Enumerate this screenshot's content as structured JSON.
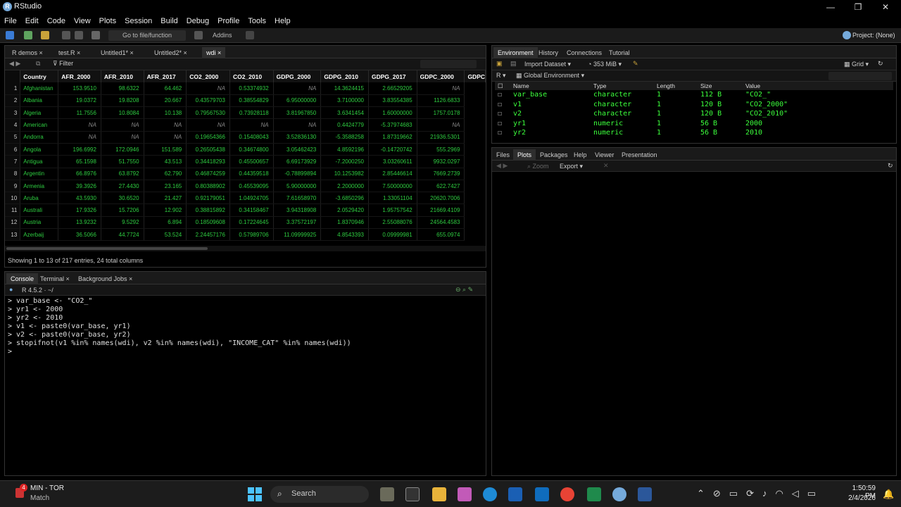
{
  "window": {
    "title": "RStudio",
    "min": "—",
    "max": "❐",
    "close": "✕"
  },
  "menu": [
    "File",
    "Edit",
    "Code",
    "View",
    "Plots",
    "Session",
    "Build",
    "Debug",
    "Profile",
    "Tools",
    "Help"
  ],
  "toolbar": {
    "goto_placeholder": "Go to file/function",
    "addins": "Addins",
    "project": "Project: (None)"
  },
  "source": {
    "tabs": [
      "R demos",
      "test.R",
      "Untitled1*",
      "Untitled2*",
      "wdi"
    ],
    "filter": "Filter",
    "columns": [
      "Country",
      "AFR_2000",
      "AFR_2010",
      "AFR_2017",
      "CO2_2000",
      "CO2_2010",
      "GDPG_2000",
      "GDPG_2010",
      "GDPG_2017",
      "GDPC_2000",
      "GDPC"
    ],
    "rows": [
      [
        "1",
        "Afghanistan",
        "153.9510",
        "98.6322",
        "64.462",
        "NA",
        "0.53374932",
        "NA",
        "14.3624415",
        "2.66529205",
        "NA"
      ],
      [
        "2",
        "Albania",
        "19.0372",
        "19.8208",
        "20.667",
        "0.43579703",
        "0.38554829",
        "6.95000000",
        "3.7100000",
        "3.83554385",
        "1126.6833"
      ],
      [
        "3",
        "Algeria",
        "11.7556",
        "10.8084",
        "10.138",
        "0.79567530",
        "0.73928118",
        "3.81967850",
        "3.6341454",
        "1.60000000",
        "1757.0178"
      ],
      [
        "4",
        "American",
        "NA",
        "NA",
        "NA",
        "NA",
        "NA",
        "NA",
        "0.4424779",
        "-5.37974683",
        "NA"
      ],
      [
        "5",
        "Andorra",
        "NA",
        "NA",
        "NA",
        "0.19654366",
        "0.15408043",
        "3.52836130",
        "-5.3588258",
        "1.87319662",
        "21936.5301"
      ],
      [
        "6",
        "Angola",
        "196.6992",
        "172.0946",
        "151.589",
        "0.26505438",
        "0.34674800",
        "3.05462423",
        "4.8592196",
        "-0.14720742",
        "555.2969"
      ],
      [
        "7",
        "Antigua",
        "65.1598",
        "51.7550",
        "43.513",
        "0.34418293",
        "0.45500657",
        "6.69173929",
        "-7.2000250",
        "3.03260611",
        "9932.0297"
      ],
      [
        "8",
        "Argentin",
        "66.8976",
        "63.8792",
        "62.790",
        "0.46874259",
        "0.44359518",
        "-0.78899894",
        "10.1253982",
        "2.85446614",
        "7669.2739"
      ],
      [
        "9",
        "Armenia",
        "39.3926",
        "27.4430",
        "23.165",
        "0.80388902",
        "0.45539095",
        "5.90000000",
        "2.2000000",
        "7.50000000",
        "622.7427"
      ],
      [
        "10",
        "Aruba",
        "43.5930",
        "30.6520",
        "21.427",
        "0.92179051",
        "1.04924705",
        "7.61658970",
        "-3.6850296",
        "1.33051104",
        "20620.7006"
      ],
      [
        "11",
        "Australi",
        "17.9326",
        "15.7206",
        "12.902",
        "0.38815892",
        "0.34158467",
        "3.94318908",
        "2.0529420",
        "1.95757542",
        "21669.4109"
      ],
      [
        "12",
        "Austria",
        "13.9232",
        "9.5292",
        "6.894",
        "0.18509608",
        "0.17224645",
        "3.37572197",
        "1.8370946",
        "2.55088076",
        "24564.4583"
      ],
      [
        "13",
        "Azerbaij",
        "36.5066",
        "44.7724",
        "53.524",
        "2.24457176",
        "0.57989706",
        "11.09999925",
        "4.8543393",
        "0.09999981",
        "655.0974"
      ]
    ],
    "status": "Showing 1 to 13 of 217 entries, 24 total columns"
  },
  "console": {
    "tabs": [
      "Console",
      "Terminal",
      "Background Jobs"
    ],
    "r_version": "R 4.5.2 · ~/",
    "lines": [
      "> var_base <- \"CO2_\"",
      "> yr1 <- 2000",
      "> yr2 <- 2010",
      "> v1 <- paste0(var_base, yr1)",
      "> v2 <- paste0(var_base, yr2)",
      "> stopifnot(v1 %in% names(wdi), v2 %in% names(wdi), \"INCOME_CAT\" %in% names(wdi))",
      "> "
    ]
  },
  "environment": {
    "tabs": [
      "Environment",
      "History",
      "Connections",
      "Tutorial"
    ],
    "import_dataset": "Import Dataset",
    "memory": "353 MiB",
    "view_mode": "Grid",
    "lang": "R",
    "scope": "Global Environment",
    "columns": [
      "Name",
      "Type",
      "Length",
      "Size",
      "Value"
    ],
    "rows": [
      [
        "var_base",
        "character",
        "1",
        "112 B",
        "\"CO2_\""
      ],
      [
        "v1",
        "character",
        "1",
        "120 B",
        "\"CO2_2000\""
      ],
      [
        "v2",
        "character",
        "1",
        "120 B",
        "\"CO2_2010\""
      ],
      [
        "yr1",
        "numeric",
        "1",
        "56 B",
        "2000"
      ],
      [
        "yr2",
        "numeric",
        "1",
        "56 B",
        "2010"
      ]
    ]
  },
  "files": {
    "tabs": [
      "Files",
      "Plots",
      "Packages",
      "Help",
      "Viewer",
      "Presentation"
    ],
    "zoom": "Zoom",
    "export": "Export"
  },
  "taskbar": {
    "weather_title": "MIN - TOR",
    "weather_sub": "Match",
    "badge": "4",
    "search": "Search",
    "time": "1:50:59 PM",
    "date": "2/4/2026"
  }
}
